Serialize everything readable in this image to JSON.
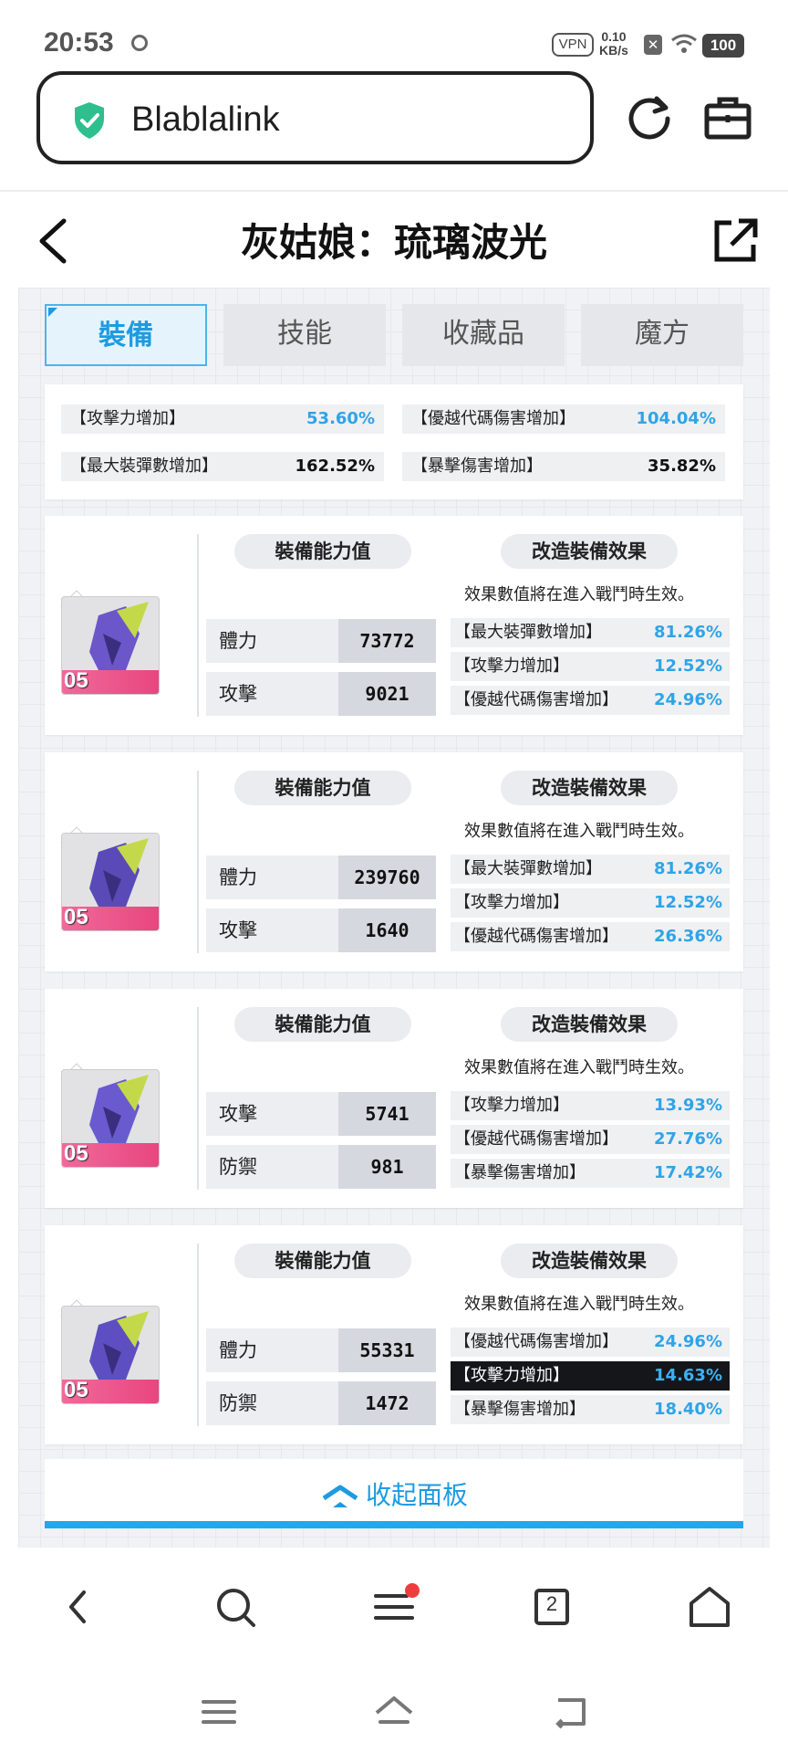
{
  "status_bar": {
    "time": "20:53",
    "vpn": "VPN",
    "speed_value": "0.10",
    "speed_unit": "KB/s",
    "battery": "100"
  },
  "browser": {
    "site_name": "Blablalink"
  },
  "page": {
    "title": "灰姑娘：琉璃波光"
  },
  "tabs": [
    {
      "label": "裝備",
      "active": true
    },
    {
      "label": "技能",
      "active": false
    },
    {
      "label": "收藏品",
      "active": false
    },
    {
      "label": "魔方",
      "active": false
    }
  ],
  "summary": [
    {
      "label": "【攻擊力增加】",
      "value": "53.60%",
      "highlight": true
    },
    {
      "label": "【優越代碼傷害增加】",
      "value": "104.04%",
      "highlight": true
    },
    {
      "label": "【最大裝彈數增加】",
      "value": "162.52%",
      "highlight": false
    },
    {
      "label": "【暴擊傷害增加】",
      "value": "35.82%",
      "highlight": false
    }
  ],
  "equipment_header": {
    "stats_title": "裝備能力值",
    "effects_title": "改造裝備效果",
    "effects_note": "效果數值將在進入戰鬥時生效。"
  },
  "equipment": [
    {
      "level": "05",
      "stats": [
        {
          "label": "體力",
          "value": "73772"
        },
        {
          "label": "攻擊",
          "value": "9021"
        }
      ],
      "effects": [
        {
          "label": "【最大裝彈數增加】",
          "value": "81.26%"
        },
        {
          "label": "【攻擊力增加】",
          "value": "12.52%"
        },
        {
          "label": "【優越代碼傷害增加】",
          "value": "24.96%"
        }
      ]
    },
    {
      "level": "05",
      "stats": [
        {
          "label": "體力",
          "value": "239760"
        },
        {
          "label": "攻擊",
          "value": "1640"
        }
      ],
      "effects": [
        {
          "label": "【最大裝彈數增加】",
          "value": "81.26%"
        },
        {
          "label": "【攻擊力增加】",
          "value": "12.52%"
        },
        {
          "label": "【優越代碼傷害增加】",
          "value": "26.36%"
        }
      ]
    },
    {
      "level": "05",
      "stats": [
        {
          "label": "攻擊",
          "value": "5741"
        },
        {
          "label": "防禦",
          "value": "981"
        }
      ],
      "effects": [
        {
          "label": "【攻擊力增加】",
          "value": "13.93%"
        },
        {
          "label": "【優越代碼傷害增加】",
          "value": "27.76%"
        },
        {
          "label": "【暴擊傷害增加】",
          "value": "17.42%"
        }
      ]
    },
    {
      "level": "05",
      "stats": [
        {
          "label": "體力",
          "value": "55331"
        },
        {
          "label": "防禦",
          "value": "1472"
        }
      ],
      "effects": [
        {
          "label": "【優越代碼傷害增加】",
          "value": "24.96%"
        },
        {
          "label": "【攻擊力增加】",
          "value": "14.63%",
          "selected": true
        },
        {
          "label": "【暴擊傷害增加】",
          "value": "18.40%"
        }
      ]
    }
  ],
  "collapse_label": "收起面板",
  "bottom_nav": {
    "tab_count": "2"
  },
  "colors": {
    "accent": "#1e9be0",
    "value_blue": "#2fa4e7",
    "level_pink": "#e8457e",
    "shield_green": "#2fbf8f"
  },
  "icons": [
    "sync-icon",
    "wifi-icon",
    "shield-icon",
    "reload-icon",
    "toolbox-icon",
    "back-arrow-icon",
    "share-icon",
    "collapse-chevron-icon",
    "search-icon",
    "menu-icon",
    "tabs-icon",
    "home-icon"
  ]
}
